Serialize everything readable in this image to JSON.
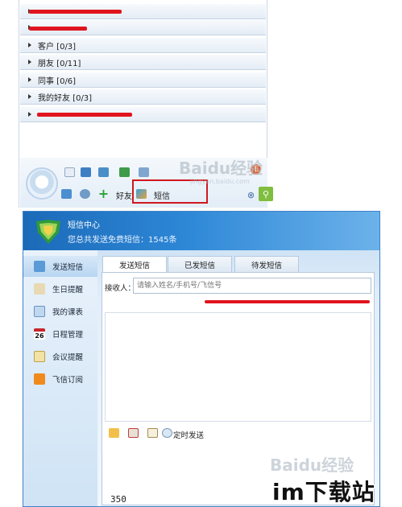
{
  "contact_list": {
    "groups": [
      {
        "label": "",
        "redacted": true
      },
      {
        "label": "",
        "redacted": true
      },
      {
        "label": "客户 [0/3]",
        "redacted": false
      },
      {
        "label": "朋友 [0/11]",
        "redacted": false
      },
      {
        "label": "同事 [0/6]",
        "redacted": false
      },
      {
        "label": "我的好友 [0/3]",
        "redacted": false
      },
      {
        "label": "",
        "redacted": true
      }
    ]
  },
  "toolbar": {
    "friend_label": "好友",
    "sms_label": "短信",
    "notification_count": "1"
  },
  "watermark": {
    "brand": "Baidu经验",
    "url": "jingyan.baidu.com"
  },
  "sms_center": {
    "title": "短信中心",
    "sent_summary": "您总共发送免费短信：1545条",
    "sidebar": [
      {
        "label": "发送短信",
        "icon": "sms-icon",
        "active": true
      },
      {
        "label": "生日提醒",
        "icon": "cake-icon",
        "active": false
      },
      {
        "label": "我的课表",
        "icon": "timetable-icon",
        "active": false
      },
      {
        "label": "日程管理",
        "icon": "calendar-icon",
        "active": false
      },
      {
        "label": "会议提醒",
        "icon": "clipboard-icon",
        "active": false
      },
      {
        "label": "飞信订阅",
        "icon": "rss-icon",
        "active": false
      }
    ],
    "calendar_day": "26",
    "tabs": [
      {
        "label": "发送短信",
        "active": true
      },
      {
        "label": "已发短信",
        "active": false
      },
      {
        "label": "待发短信",
        "active": false
      }
    ],
    "recipient_label": "接收人：",
    "recipient_placeholder": "请输入姓名/手机号/飞信号",
    "recipient_value": "",
    "schedule_label": "定时发送",
    "char_count": "350"
  },
  "site_logo": "im下载站",
  "colors": {
    "accent_blue": "#2d87d6",
    "redaction_red": "#e0141e",
    "highlight_red": "#d0181f"
  }
}
